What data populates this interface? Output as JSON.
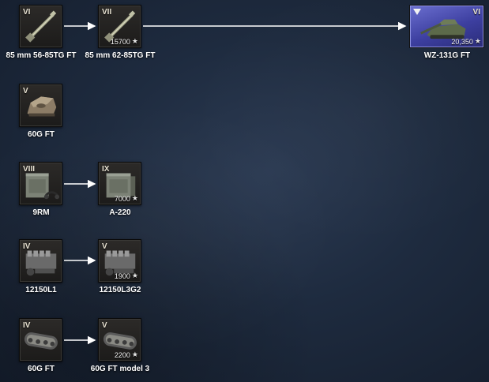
{
  "connectors": [
    {
      "from": "gun-85mm-56-85tg",
      "to": "gun-85mm-62-85tg"
    },
    {
      "from": "gun-85mm-62-85tg",
      "to": "vehicle-wz-131g"
    },
    {
      "from": "radio-9rm",
      "to": "radio-a220"
    },
    {
      "from": "engine-12150l1",
      "to": "engine-12150l3g2"
    },
    {
      "from": "tracks-60g-ft",
      "to": "tracks-60g-ft-model3"
    }
  ],
  "modules": {
    "gun1": {
      "tier": "VI",
      "label": "85 mm 56-85TG FT",
      "icon": "gun-icon"
    },
    "gun2": {
      "tier": "VII",
      "label": "85 mm 62-85TG FT",
      "cost": "15700",
      "icon": "gun-icon"
    },
    "vehicle": {
      "tier": "VI",
      "label": "WZ-131G FT",
      "cost": "20,350",
      "icon": "tank-destroyer-icon"
    },
    "turret": {
      "tier": "V",
      "label": "60G FT",
      "icon": "turret-icon"
    },
    "radio1": {
      "tier": "VIII",
      "label": "9RM",
      "icon": "radio-icon"
    },
    "radio2": {
      "tier": "IX",
      "label": "A-220",
      "cost": "7000",
      "icon": "radio-icon"
    },
    "engine1": {
      "tier": "IV",
      "label": "12150L1",
      "icon": "engine-icon"
    },
    "engine2": {
      "tier": "V",
      "label": "12150L3G2",
      "cost": "1900",
      "icon": "engine-icon"
    },
    "tracks1": {
      "tier": "IV",
      "label": "60G FT",
      "icon": "tracks-icon"
    },
    "tracks2": {
      "tier": "V",
      "label": "60G FT model 3",
      "cost": "2200",
      "icon": "tracks-icon"
    }
  },
  "colors": {
    "vehicle_bg": "#4a4db5",
    "background": "#1e2b3f",
    "connector": "#ffffff"
  }
}
